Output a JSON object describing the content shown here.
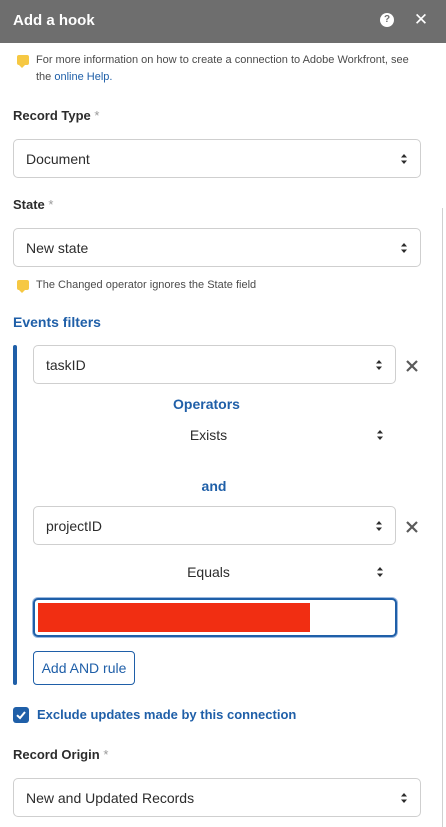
{
  "header": {
    "title": "Add a hook",
    "help_icon": "question-icon",
    "close_icon": "close-icon"
  },
  "info_note": {
    "text": "For more information on how to create a connection to Adobe Workfront, see the",
    "link": "online Help."
  },
  "record_type": {
    "label": "Record Type",
    "required": "*",
    "value": "Document"
  },
  "state": {
    "label": "State",
    "required": "*",
    "value": "New state"
  },
  "state_note": {
    "text": "The Changed operator ignores the State field"
  },
  "events_filters": {
    "label": "Events filters",
    "rule1": {
      "field": "taskID",
      "operators_label": "Operators",
      "operator": "Exists"
    },
    "conjunction": "and",
    "rule2": {
      "field": "projectID",
      "operator": "Equals",
      "value": ""
    },
    "add_and_rule": "Add AND rule"
  },
  "exclude_updates": {
    "label": "Exclude updates made by this connection",
    "checked": true
  },
  "record_origin": {
    "label": "Record Origin",
    "required": "*",
    "value": "New and Updated Records"
  },
  "colors": {
    "accent": "#1f5fa8",
    "header": "#6e6e6e",
    "note": "#f6c843",
    "redacted": "#f12e12"
  }
}
